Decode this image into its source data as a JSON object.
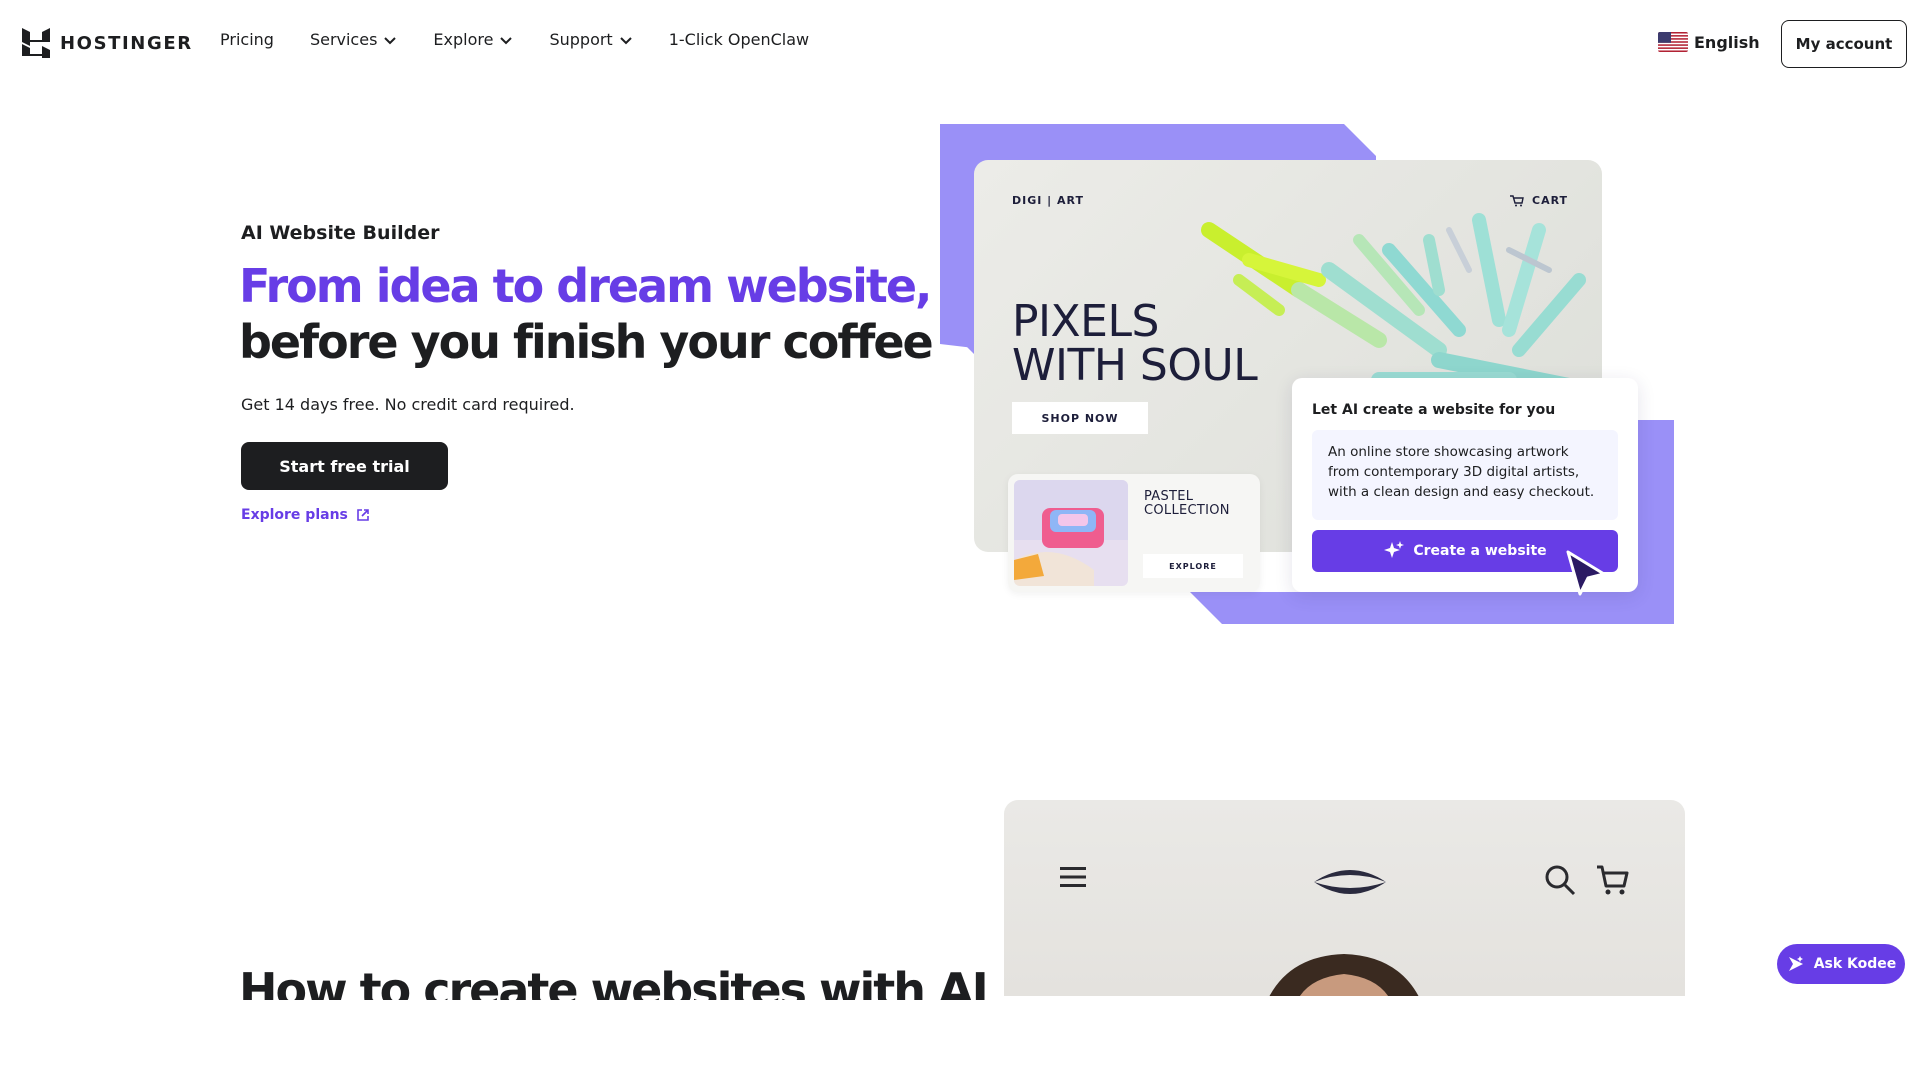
{
  "header": {
    "logo_text": "HOSTINGER",
    "nav": [
      {
        "label": "Pricing",
        "has_dropdown": false
      },
      {
        "label": "Services",
        "has_dropdown": true
      },
      {
        "label": "Explore",
        "has_dropdown": true
      },
      {
        "label": "Support",
        "has_dropdown": true
      },
      {
        "label": "1-Click OpenClaw",
        "has_dropdown": false
      }
    ],
    "language": "English",
    "language_flag": "us-flag-icon",
    "account_label": "My account"
  },
  "hero": {
    "eyebrow": "AI Website Builder",
    "headline_accent": "From idea to dream website,",
    "headline_dark": "before you finish your coffee",
    "subtext": "Get 14 days free. No credit card required.",
    "cta_label": "Start free trial",
    "explore_label": "Explore plans"
  },
  "illustration": {
    "store_brand": "DIGI | ART",
    "store_cart": "CART",
    "store_headline_line1": "PIXELS",
    "store_headline_line2": "WITH SOUL",
    "shop_now": "SHOP NOW",
    "pastel_line1": "PASTEL",
    "pastel_line2": "COLLECTION",
    "pastel_explore": "EXPLORE",
    "ai_card_title": "Let AI create a website for you",
    "ai_prompt": "An online store showcasing artwork from contemporary 3D digital artists, with a clean design and easy checkout.",
    "ai_button": "Create a website"
  },
  "section2": {
    "title": "How to create websites with AI"
  },
  "kodee": {
    "label": "Ask Kodee"
  },
  "colors": {
    "brand_purple": "#673de6",
    "illustration_purple": "#9a90f7",
    "dark": "#1d1e20"
  }
}
